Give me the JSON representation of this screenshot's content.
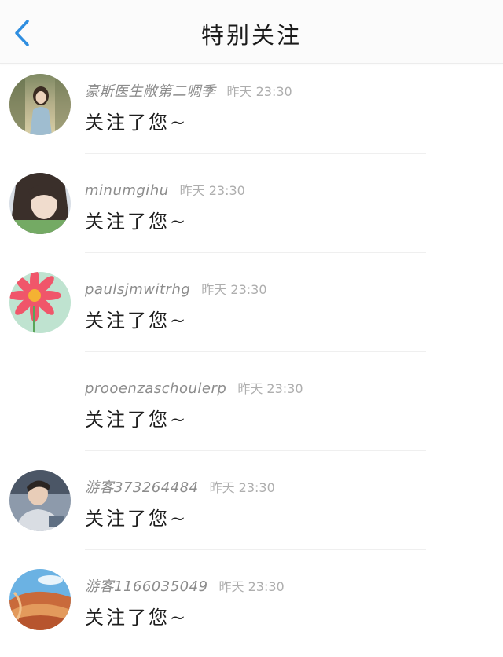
{
  "header": {
    "title": "特别关注",
    "back_icon": "chevron-left-icon",
    "accent_color": "#2f8ee0"
  },
  "items": [
    {
      "name": "豪斯医生敞第二啁季",
      "time": "昨天 23:30",
      "message": "关注了您~",
      "avatar": "avatar-girl-photo"
    },
    {
      "name": "minumgihu",
      "time": "昨天 23:30",
      "message": "关注了您~",
      "avatar": "avatar-girl-closeup"
    },
    {
      "name": "paulsjmwitrhg",
      "time": "昨天 23:30",
      "message": "关注了您~",
      "avatar": "avatar-red-flower"
    },
    {
      "name": "prooenzaschoulerp",
      "time": "昨天 23:30",
      "message": "关注了您~",
      "avatar": "none"
    },
    {
      "name": "游客373264484",
      "time": "昨天 23:30",
      "message": "关注了您~",
      "avatar": "avatar-boy-photo"
    },
    {
      "name": "游客1166035049",
      "time": "昨天 23:30",
      "message": "关注了您~",
      "avatar": "avatar-canyon-photo"
    }
  ]
}
